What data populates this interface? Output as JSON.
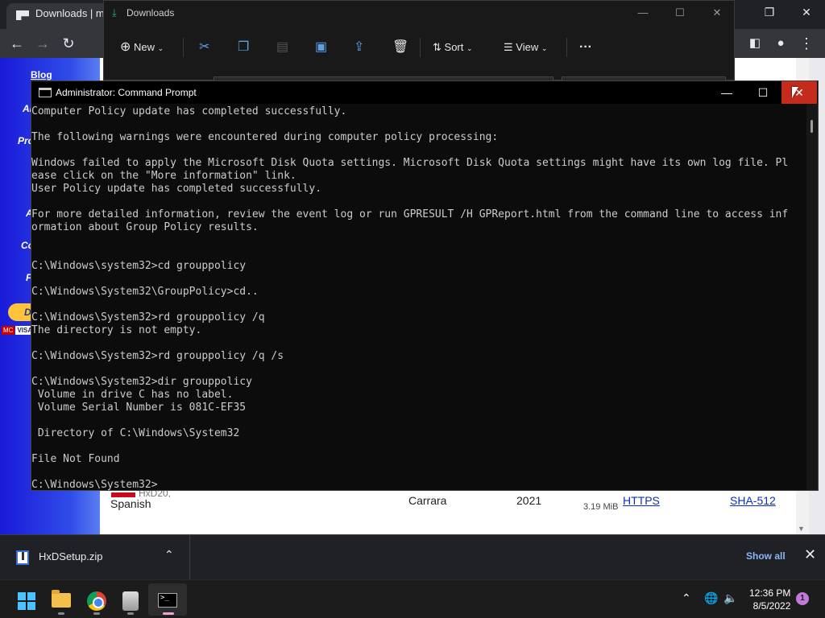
{
  "browser": {
    "tab_title": "Downloads | mh",
    "site_nav": [
      "Blog",
      "Ab",
      "Pro",
      "A",
      "Co",
      "F"
    ],
    "paypal_text": "D",
    "cards": [
      "MC",
      "VISA"
    ],
    "download_row": {
      "name_top": "HxD20,",
      "name": "Spanish",
      "author": "Carrara",
      "year": "2021",
      "size": "3.19 MiB",
      "link_https": "HTTPS",
      "link_sha": "SHA-512"
    },
    "downloads_bar": {
      "file": "HxDSetup.zip",
      "show_all": "Show all"
    }
  },
  "explorer": {
    "title": "Downloads",
    "toolbar": {
      "new_label": "New",
      "sort_label": "Sort",
      "view_label": "View"
    }
  },
  "cmd": {
    "title": "Administrator: Command Prompt",
    "lines": [
      "Computer Policy update has completed successfully.",
      "",
      "The following warnings were encountered during computer policy processing:",
      "",
      "Windows failed to apply the Microsoft Disk Quota settings. Microsoft Disk Quota settings might have its own log file. Pl",
      "ease click on the \"More information\" link.",
      "User Policy update has completed successfully.",
      "",
      "For more detailed information, review the event log or run GPRESULT /H GPReport.html from the command line to access inf",
      "ormation about Group Policy results.",
      "",
      "",
      "C:\\Windows\\system32>cd grouppolicy",
      "",
      "C:\\Windows\\System32\\GroupPolicy>cd..",
      "",
      "C:\\Windows\\System32>rd grouppolicy /q",
      "The directory is not empty.",
      "",
      "C:\\Windows\\System32>rd grouppolicy /q /s",
      "",
      "C:\\Windows\\System32>dir grouppolicy",
      " Volume in drive C has no label.",
      " Volume Serial Number is 081C-EF35",
      "",
      " Directory of C:\\Windows\\System32",
      "",
      "File Not Found",
      "",
      "C:\\Windows\\System32>"
    ]
  },
  "taskbar": {
    "apps": [
      "start",
      "file-explorer",
      "chrome",
      "setup",
      "command-prompt"
    ],
    "time": "12:36 PM",
    "date": "8/5/2022",
    "notification_count": "1"
  }
}
